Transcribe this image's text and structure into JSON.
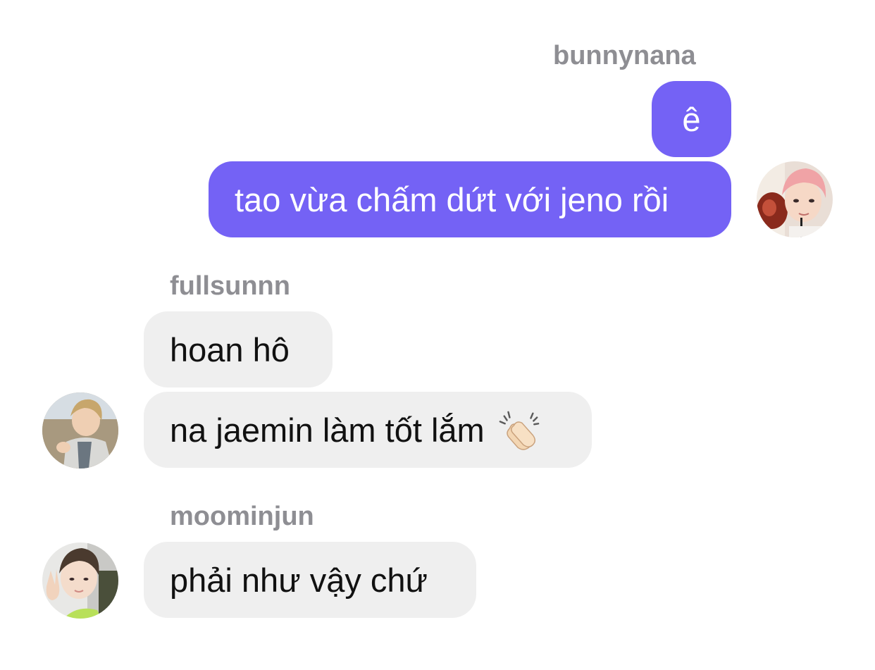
{
  "thread": {
    "group1": {
      "sender": "bunnynana",
      "messages": [
        "ê",
        "tao vừa chấm dứt với jeno rồi"
      ],
      "avatar_icon": "avatar-pink-hair-boy"
    },
    "group2": {
      "sender": "fullsunnn",
      "messages": [
        "hoan hô",
        "na jaemin làm tốt lắm"
      ],
      "emoji": "clapping-hands-emoji",
      "avatar_icon": "avatar-boy-outdoors"
    },
    "group3": {
      "sender": "moominjun",
      "messages": [
        "phải như vậy chứ"
      ],
      "avatar_icon": "avatar-boy-peace-sign"
    }
  },
  "colors": {
    "outgoing_bubble": "#7462f5",
    "incoming_bubble": "#efefef",
    "sender_name": "#8e8e93"
  }
}
